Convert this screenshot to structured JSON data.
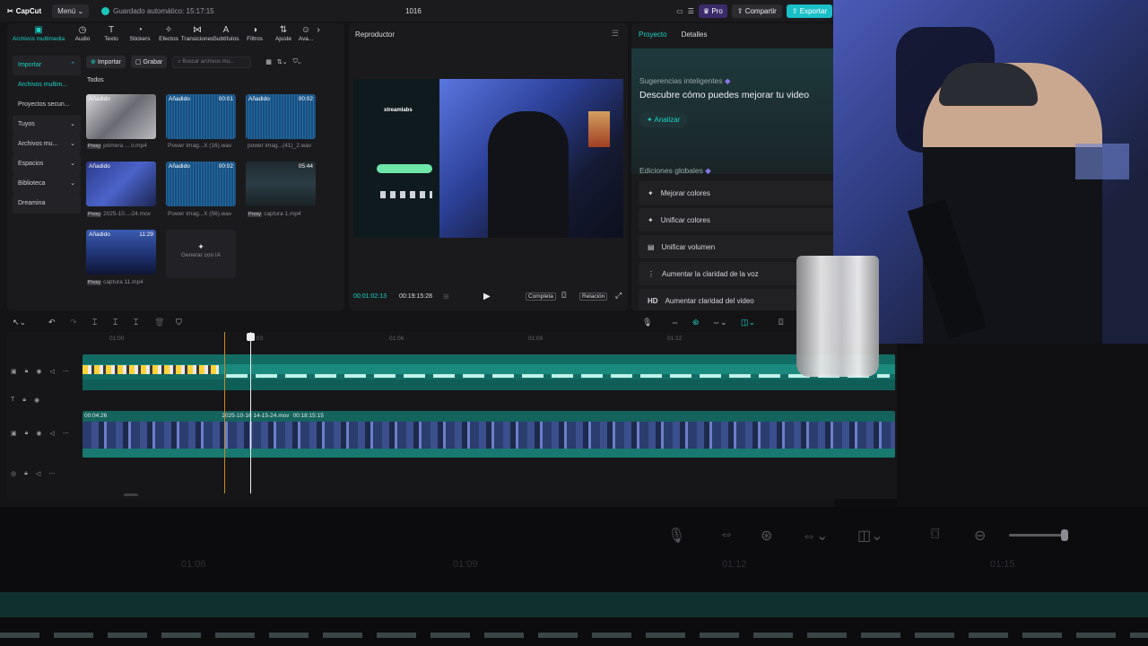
{
  "topbar": {
    "app_name": "CapCut",
    "menu_label": "Menú",
    "autosave": "Guardado automático: 15:17:15",
    "project_title": "1016",
    "pro_label": "Pro",
    "share_label": "Compartir",
    "export_label": "Exportar"
  },
  "toolbar": {
    "items": [
      {
        "label": "Archivos multimedia",
        "icon": "media-icon"
      },
      {
        "label": "Audio",
        "icon": "audio-icon"
      },
      {
        "label": "Texto",
        "icon": "text-icon"
      },
      {
        "label": "Stickers",
        "icon": "sticker-icon"
      },
      {
        "label": "Efectos",
        "icon": "effects-icon"
      },
      {
        "label": "Transiciones",
        "icon": "transitions-icon"
      },
      {
        "label": "Subtítulos",
        "icon": "subtitles-icon"
      },
      {
        "label": "Filtros",
        "icon": "filters-icon"
      },
      {
        "label": "Ajuste",
        "icon": "adjust-icon"
      },
      {
        "label": "Ava...",
        "icon": "avatar-icon"
      }
    ]
  },
  "sidenav": {
    "items": [
      "Importar",
      "Archivos multim...",
      "Proyectos secun...",
      "Tuyos",
      "Archivos mu...",
      "Espacios",
      "Biblioteca",
      "Dreamina"
    ]
  },
  "media": {
    "import_label": "Importar",
    "record_label": "Grabar",
    "search_placeholder": "Buscar archivos mu...",
    "section": "Todos",
    "added_tag": "Añadido",
    "proxy_tag": "Proxy",
    "generate_label": "Generar con IA",
    "items": [
      {
        "name": "primera ... ir.mp4",
        "duration": ""
      },
      {
        "name": "Power Imag...X (16).wav",
        "duration": "00:01"
      },
      {
        "name": "power imag...(41)_2.wav",
        "duration": "00:02"
      },
      {
        "name": "2025-10...-24.mov",
        "duration": ""
      },
      {
        "name": "Power Imag...X (56).wav",
        "duration": "00:02"
      },
      {
        "name": "captura 1.mp4",
        "duration": "05:44"
      },
      {
        "name": "captura 11.mp4",
        "duration": "11:29"
      }
    ]
  },
  "player": {
    "title": "Reproductor",
    "current_time": "00:01:02:13",
    "total_time": "00:19:15:28",
    "full_label": "Completa",
    "ratio_label": "Relación",
    "phone_brand": "streamlabs"
  },
  "props": {
    "tab_project": "Proyecto",
    "tab_details": "Detalles",
    "smart_title": "Sugerencias inteligentes",
    "smart_heading": "Descubre cómo puedes mejorar tu video",
    "analyze_label": "Analizar",
    "global_title": "Ediciones globales",
    "global_items": [
      "Mejorar colores",
      "Unificar colores",
      "Unificar volumen",
      "Aumentar la claridad de la voz",
      "Aumentar claridad del video"
    ],
    "hd_label": "HD"
  },
  "timeline": {
    "ruler": [
      "01:00",
      "01:03",
      "01:06",
      "01:09",
      "01:12"
    ],
    "clip_start": "00:04:26",
    "clip_name": "2025-10-16 14-15-24.mov",
    "clip_duration": "00:18:15:15"
  },
  "lower": {
    "ruler": [
      "01:06",
      "01:09",
      "01:12",
      "01:15"
    ]
  },
  "colors": {
    "accent": "#1ad1c4",
    "export": "#1ac0c8",
    "clip_teal": "#126c64"
  }
}
